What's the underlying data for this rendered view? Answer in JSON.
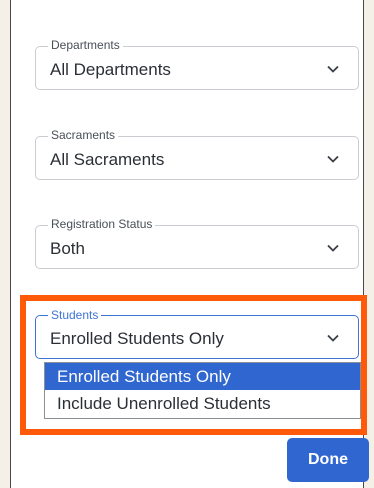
{
  "filters": {
    "departments": {
      "label": "Departments",
      "value": "All Departments"
    },
    "sacraments": {
      "label": "Sacraments",
      "value": "All Sacraments"
    },
    "registration_status": {
      "label": "Registration Status",
      "value": "Both"
    },
    "students": {
      "label": "Students",
      "value": "Enrolled Students Only",
      "options": [
        "Enrolled Students Only",
        "Include Unenrolled Students"
      ],
      "selected_index": 0
    }
  },
  "done_label": "Done",
  "icons": {
    "dropdown": "chevron-down-icon"
  },
  "colors": {
    "accent": "#2f66d0",
    "highlight_border": "#ff5a0a",
    "background": "#f4efe7"
  }
}
